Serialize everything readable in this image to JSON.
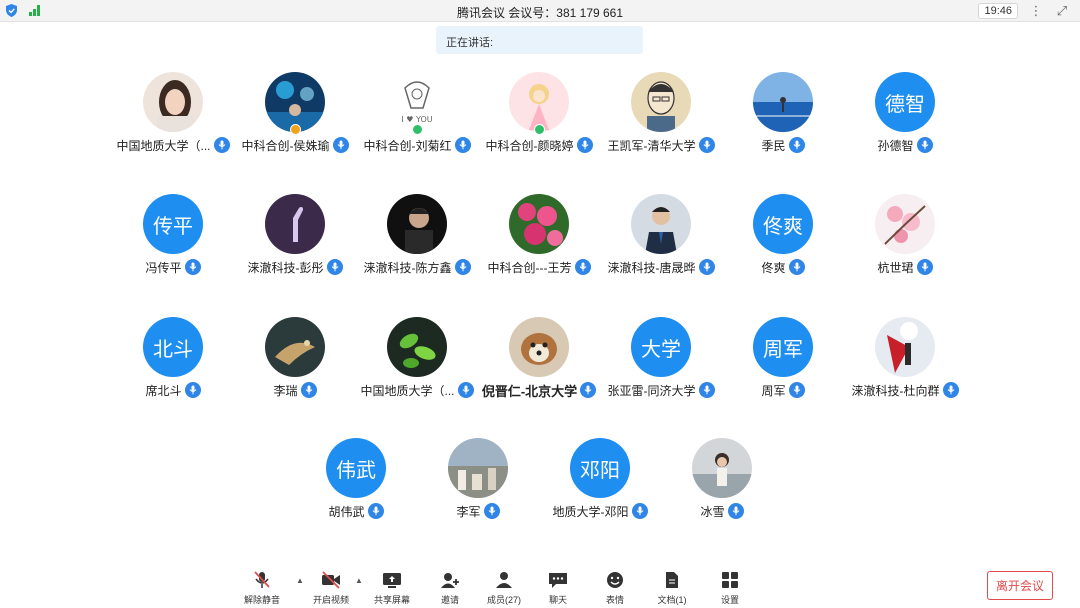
{
  "titlebar": {
    "title": "腾讯会议 会议号：381 179 661",
    "time": "19:46"
  },
  "speaking": {
    "label": "正在讲话:"
  },
  "participants": [
    {
      "name": "中国地质大学（...",
      "avatar_type": "photo",
      "photo_hint": "woman-portrait"
    },
    {
      "name": "中科合创-侯姝瑜",
      "avatar_type": "photo",
      "photo_hint": "stage-lights",
      "badge": "orange"
    },
    {
      "name": "中科合创-刘菊红",
      "avatar_type": "photo",
      "photo_hint": "sketch-i-love-you",
      "badge": "green"
    },
    {
      "name": "中科合创-颜晓婷",
      "avatar_type": "photo",
      "photo_hint": "cartoon-girl",
      "badge": "green"
    },
    {
      "name": "王凯军-清华大学",
      "avatar_type": "photo",
      "photo_hint": "cartoon-man"
    },
    {
      "name": "季民",
      "avatar_type": "photo",
      "photo_hint": "tennis-court"
    },
    {
      "name": "孙德智",
      "avatar_type": "text",
      "avatar_text": "德智"
    },
    {
      "name": "冯传平",
      "avatar_type": "text",
      "avatar_text": "传平"
    },
    {
      "name": "涞澈科技-彭彤",
      "avatar_type": "photo",
      "photo_hint": "purple-giraffe"
    },
    {
      "name": "涞澈科技-陈方鑫",
      "avatar_type": "photo",
      "photo_hint": "man-dark"
    },
    {
      "name": "中科合创---王芳",
      "avatar_type": "photo",
      "photo_hint": "pink-flowers"
    },
    {
      "name": "涞澈科技-唐晟晔",
      "avatar_type": "photo",
      "photo_hint": "man-suit"
    },
    {
      "name": "佟爽",
      "avatar_type": "text",
      "avatar_text": "佟爽"
    },
    {
      "name": "杭世珺",
      "avatar_type": "photo",
      "photo_hint": "cherry-blossom"
    },
    {
      "name": "席北斗",
      "avatar_type": "text",
      "avatar_text": "北斗"
    },
    {
      "name": "李瑞",
      "avatar_type": "photo",
      "photo_hint": "bird-painting"
    },
    {
      "name": "中国地质大学（...",
      "avatar_type": "photo",
      "photo_hint": "green-leaves"
    },
    {
      "name": "倪晋仁-北京大学",
      "avatar_type": "photo",
      "photo_hint": "dog",
      "bold": true
    },
    {
      "name": "张亚雷-同济大学",
      "avatar_type": "text",
      "avatar_text": "大学"
    },
    {
      "name": "周军",
      "avatar_type": "text",
      "avatar_text": "周军"
    },
    {
      "name": "涞澈科技-杜向群",
      "avatar_type": "photo",
      "photo_hint": "red-cape"
    },
    {
      "name": "胡伟武",
      "avatar_type": "text",
      "avatar_text": "伟武"
    },
    {
      "name": "李军",
      "avatar_type": "photo",
      "photo_hint": "city-aerial"
    },
    {
      "name": "地质大学-邓阳",
      "avatar_type": "text",
      "avatar_text": "邓阳"
    },
    {
      "name": "冰雪",
      "avatar_type": "photo",
      "photo_hint": "woman-outdoor"
    }
  ],
  "toolbar": {
    "items": [
      {
        "label": "解除静音",
        "icon": "mic-off-icon"
      },
      {
        "label": "开启视频",
        "icon": "video-off-icon"
      },
      {
        "label": "共享屏幕",
        "icon": "share-screen-icon"
      },
      {
        "label": "邀请",
        "icon": "invite-icon"
      },
      {
        "label": "成员(27)",
        "icon": "members-icon"
      },
      {
        "label": "聊天",
        "icon": "chat-icon"
      },
      {
        "label": "表情",
        "icon": "emoji-icon"
      },
      {
        "label": "文档(1)",
        "icon": "document-icon"
      },
      {
        "label": "设置",
        "icon": "settings-icon"
      }
    ],
    "leave_label": "离开会议"
  },
  "colors": {
    "accent": "#1e8ef0",
    "mic_badge": "#2f86e6",
    "leave": "#e24b4b"
  }
}
